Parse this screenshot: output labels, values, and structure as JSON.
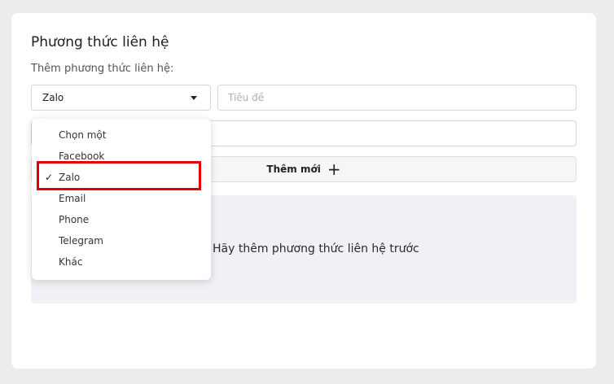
{
  "section": {
    "title": "Phương thức liên hệ",
    "sub_label": "Thêm phương thức liên hệ:"
  },
  "contact_type_select": {
    "selected": "Zalo"
  },
  "title_input": {
    "placeholder": "Tiêu đề",
    "value": ""
  },
  "value_input": {
    "placeholder": "",
    "value": ""
  },
  "add_button": {
    "label": "Thêm mới",
    "icon": "plus-icon"
  },
  "empty_state": {
    "message": "Hãy thêm phương thức liên hệ trước"
  },
  "dropdown": {
    "check_mark": "✓",
    "options": [
      {
        "label": "Chọn một",
        "selected": false
      },
      {
        "label": "Facebook",
        "selected": false
      },
      {
        "label": "Zalo",
        "selected": true
      },
      {
        "label": "Email",
        "selected": false
      },
      {
        "label": "Phone",
        "selected": false
      },
      {
        "label": "Telegram",
        "selected": false
      },
      {
        "label": "Khác",
        "selected": false
      }
    ]
  },
  "colors": {
    "highlight_border": "#e00000",
    "empty_bg": "#eff1f6",
    "page_bg": "#ececec"
  }
}
